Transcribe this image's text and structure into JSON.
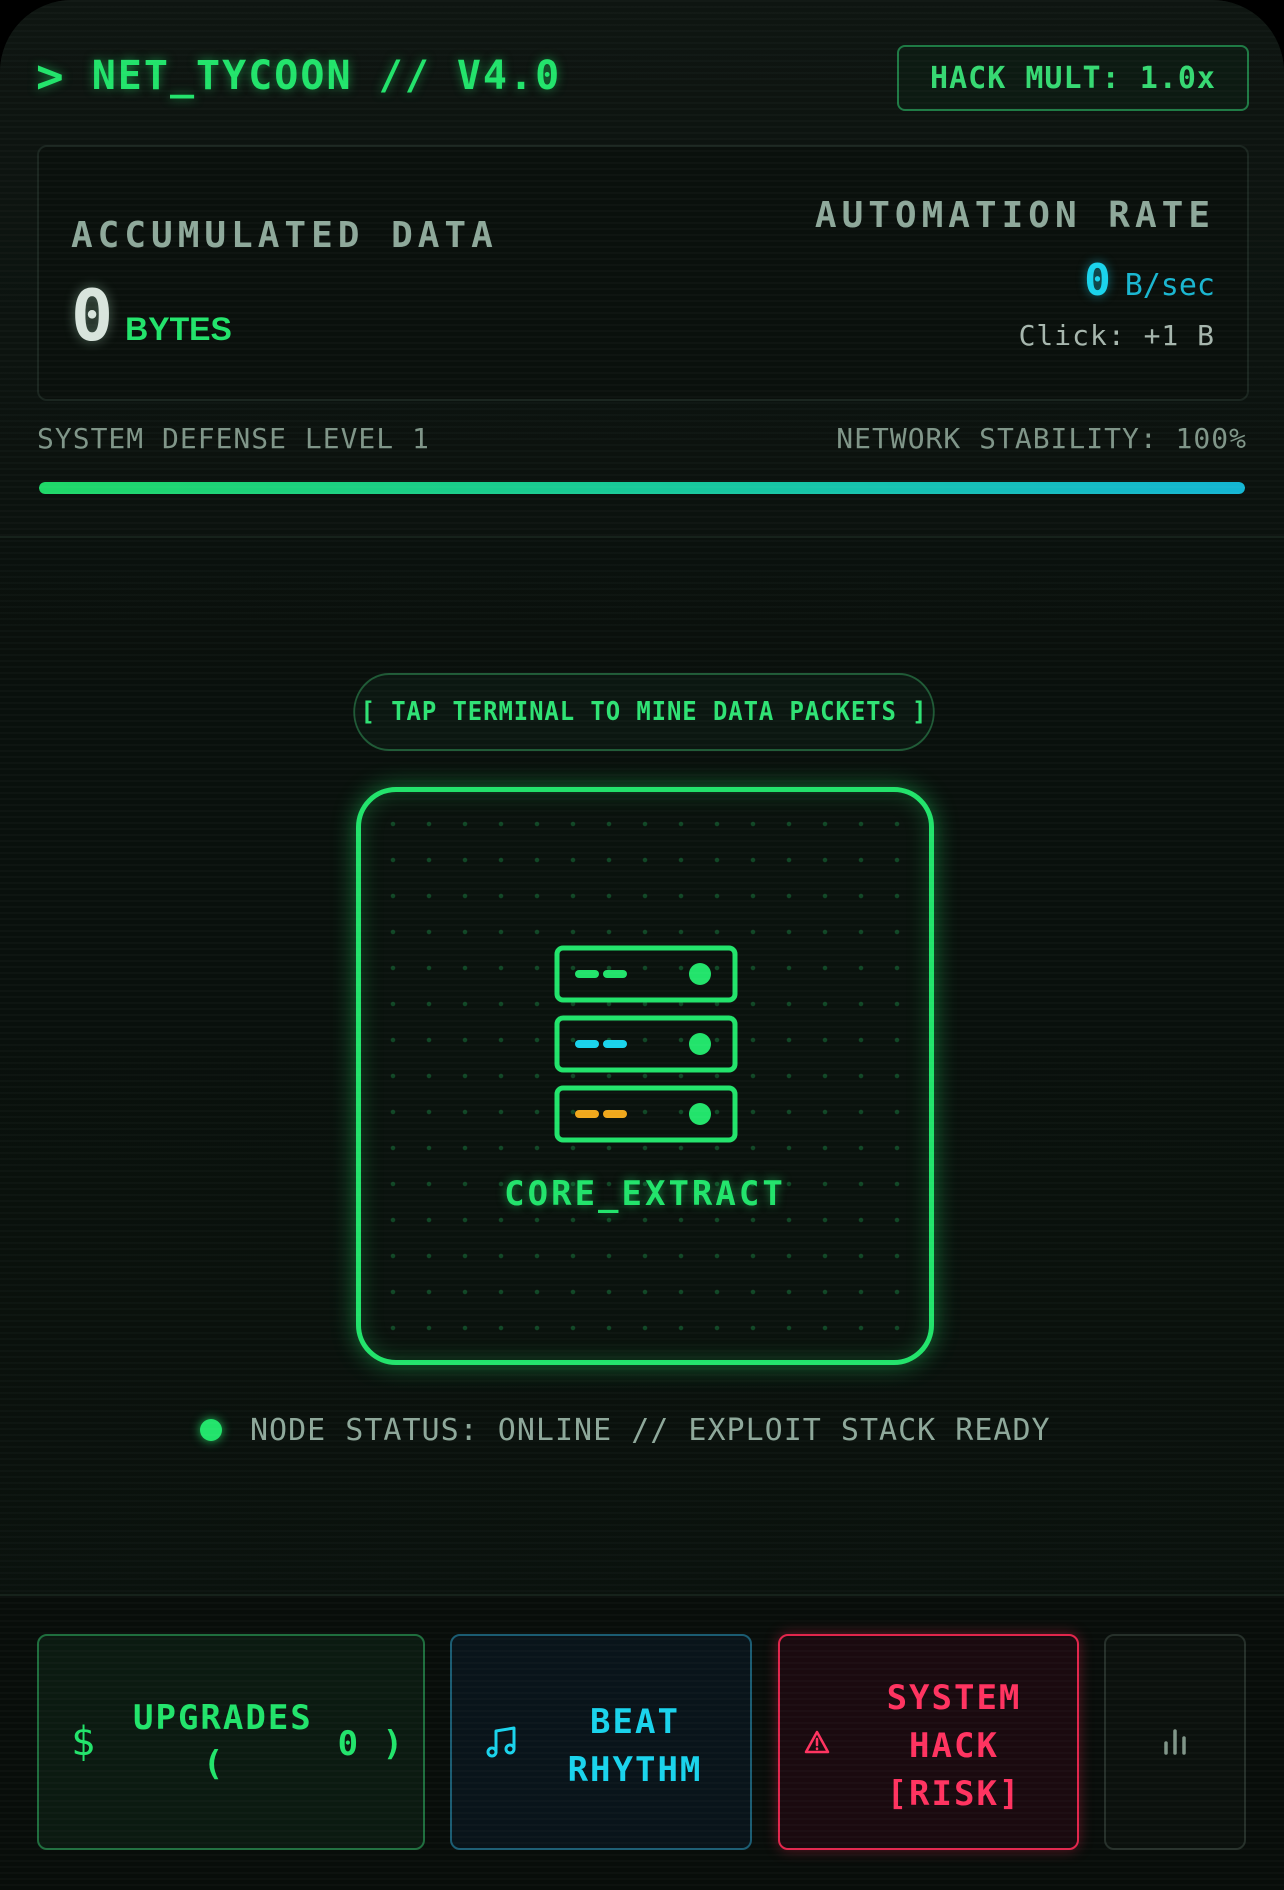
{
  "header": {
    "prompt": ">",
    "title": "NET_TYCOON // V4.0",
    "hack_mult": "HACK MULT: 1.0x"
  },
  "stats": {
    "accumulated_label": "ACCUMULATED DATA",
    "accumulated_value": "0",
    "accumulated_unit": "BYTES",
    "automation_label": "AUTOMATION RATE",
    "automation_value": "0",
    "automation_unit": "B/sec",
    "click_rate": "Click: +1 B"
  },
  "defense": {
    "level_text": "SYSTEM DEFENSE LEVEL 1",
    "stability_text": "NETWORK STABILITY: 100%",
    "stability_fraction": 1.0
  },
  "main": {
    "hint": "[ TAP TERMINAL TO MINE DATA PACKETS ]",
    "core_label": "CORE_EXTRACT",
    "node_status": "NODE STATUS: ONLINE // EXPLOIT STACK READY"
  },
  "footer": {
    "upgrades_label": "UPGRADES",
    "upgrades_open": "(",
    "upgrades_count": "0 )",
    "beat_line1": "BEAT",
    "beat_line2": "RHYTHM",
    "hack_line1": "SYSTEM",
    "hack_line2": "HACK",
    "hack_line3": "[RISK]"
  },
  "icons": {
    "upgrades": "dollar-icon",
    "beat": "music-note-icon",
    "hack": "warning-icon",
    "stats": "bar-chart-icon",
    "terminal": "server-icon"
  },
  "colors": {
    "primary_green": "#22e36b",
    "cyan": "#1ad3ec",
    "amber": "#f0a81c",
    "danger_red": "#ff3360"
  }
}
